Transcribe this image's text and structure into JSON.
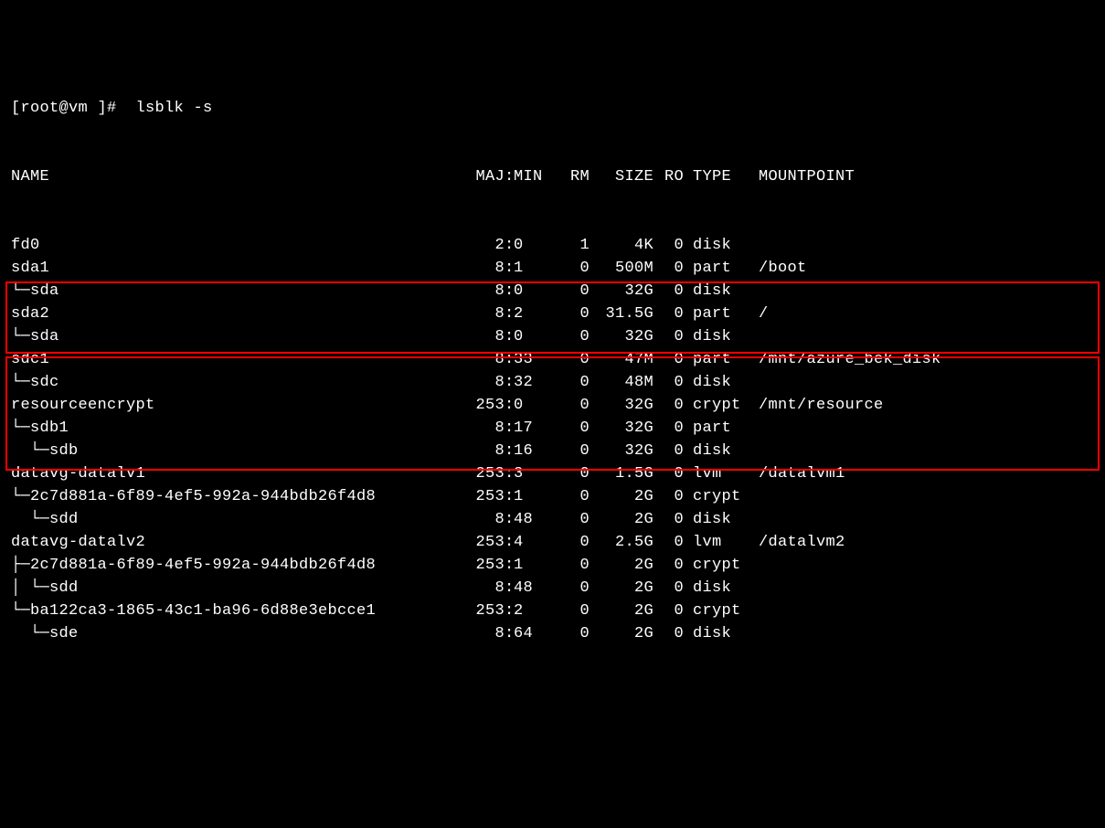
{
  "prompt": "[root@vm ]#  lsblk -s",
  "headers": {
    "name": "NAME",
    "majmin": "MAJ:MIN",
    "rm": "RM",
    "size": "SIZE",
    "ro": "RO",
    "type": "TYPE",
    "mountpoint": "MOUNTPOINT"
  },
  "rows": [
    {
      "name": "fd0",
      "maj": "2",
      "min": "0",
      "rm": "1",
      "size": "4K",
      "ro": "0",
      "type": "disk",
      "mnt": ""
    },
    {
      "name": "sda1",
      "maj": "8",
      "min": "1",
      "rm": "0",
      "size": "500M",
      "ro": "0",
      "type": "part",
      "mnt": "/boot"
    },
    {
      "name": "└─sda",
      "maj": "8",
      "min": "0",
      "rm": "0",
      "size": "32G",
      "ro": "0",
      "type": "disk",
      "mnt": ""
    },
    {
      "name": "sda2",
      "maj": "8",
      "min": "2",
      "rm": "0",
      "size": "31.5G",
      "ro": "0",
      "type": "part",
      "mnt": "/"
    },
    {
      "name": "└─sda",
      "maj": "8",
      "min": "0",
      "rm": "0",
      "size": "32G",
      "ro": "0",
      "type": "disk",
      "mnt": ""
    },
    {
      "name": "sdc1",
      "maj": "8",
      "min": "33",
      "rm": "0",
      "size": "47M",
      "ro": "0",
      "type": "part",
      "mnt": "/mnt/azure_bek_disk"
    },
    {
      "name": "└─sdc",
      "maj": "8",
      "min": "32",
      "rm": "0",
      "size": "48M",
      "ro": "0",
      "type": "disk",
      "mnt": ""
    },
    {
      "name": "resourceencrypt",
      "maj": "253",
      "min": "0",
      "rm": "0",
      "size": "32G",
      "ro": "0",
      "type": "crypt",
      "mnt": "/mnt/resource"
    },
    {
      "name": "└─sdb1",
      "maj": "8",
      "min": "17",
      "rm": "0",
      "size": "32G",
      "ro": "0",
      "type": "part",
      "mnt": ""
    },
    {
      "name": "  └─sdb",
      "maj": "8",
      "min": "16",
      "rm": "0",
      "size": "32G",
      "ro": "0",
      "type": "disk",
      "mnt": ""
    },
    {
      "name": "datavg-datalv1",
      "maj": "253",
      "min": "3",
      "rm": "0",
      "size": "1.5G",
      "ro": "0",
      "type": "lvm",
      "mnt": "/datalvm1"
    },
    {
      "name": "└─2c7d881a-6f89-4ef5-992a-944bdb26f4d8",
      "maj": "253",
      "min": "1",
      "rm": "0",
      "size": "2G",
      "ro": "0",
      "type": "crypt",
      "mnt": ""
    },
    {
      "name": "  └─sdd",
      "maj": "8",
      "min": "48",
      "rm": "0",
      "size": "2G",
      "ro": "0",
      "type": "disk",
      "mnt": ""
    },
    {
      "name": "datavg-datalv2",
      "maj": "253",
      "min": "4",
      "rm": "0",
      "size": "2.5G",
      "ro": "0",
      "type": "lvm",
      "mnt": "/datalvm2"
    },
    {
      "name": "├─2c7d881a-6f89-4ef5-992a-944bdb26f4d8",
      "maj": "253",
      "min": "1",
      "rm": "0",
      "size": "2G",
      "ro": "0",
      "type": "crypt",
      "mnt": ""
    },
    {
      "name": "│ └─sdd",
      "maj": "8",
      "min": "48",
      "rm": "0",
      "size": "2G",
      "ro": "0",
      "type": "disk",
      "mnt": ""
    },
    {
      "name": "└─ba122ca3-1865-43c1-ba96-6d88e3ebcce1",
      "maj": "253",
      "min": "2",
      "rm": "0",
      "size": "2G",
      "ro": "0",
      "type": "crypt",
      "mnt": ""
    },
    {
      "name": "  └─sde",
      "maj": "8",
      "min": "64",
      "rm": "0",
      "size": "2G",
      "ro": "0",
      "type": "disk",
      "mnt": ""
    }
  ]
}
